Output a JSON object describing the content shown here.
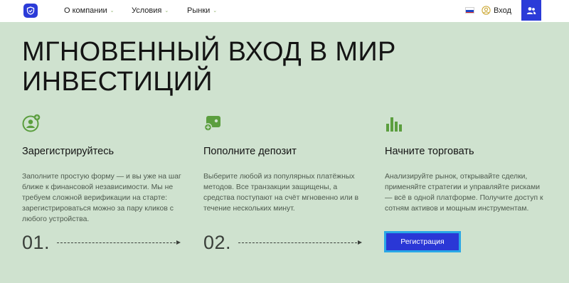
{
  "colors": {
    "accent": "#2b3bd8",
    "background": "#cfe2cf",
    "icon_green": "#5b9e3e",
    "button_border": "#2aa7e6"
  },
  "header": {
    "logo_icon": "shield-logo-icon",
    "nav": [
      {
        "label": "О компании"
      },
      {
        "label": "Условия"
      },
      {
        "label": "Рынки"
      }
    ],
    "login_label": "Вход",
    "flag_icon": "russia-flag-icon",
    "user_icon": "users-icon"
  },
  "hero": {
    "title_line1": "МГНОВЕННЫЙ ВХОД В МИР",
    "title_line2": "ИНВЕСТИЦИЙ"
  },
  "columns": [
    {
      "icon": "user-add-icon",
      "title": "Зарегистрируйтесь",
      "text": "Заполните простую форму — и вы уже на шаг ближе к финансовой независимости. Мы не требуем сложной верификации на старте: зарегистрироваться можно за пару кликов с любого устройства.",
      "step": "01."
    },
    {
      "icon": "wallet-plus-icon",
      "title": "Пополните депозит",
      "text": "Выберите любой из популярных платёжных методов. Все транзакции защищены, а средства поступают на счёт мгновенно или в течение нескольких минут.",
      "step": "02."
    },
    {
      "icon": "bar-chart-icon",
      "title": "Начните торговать",
      "text": "Анализируйте рынок, открывайте сделки, применяйте стратегии и управляйте рисками — всё в одной платформе. Получите доступ к сотням активов и мощным инструментам."
    }
  ],
  "cta": {
    "register_label": "Регистрация"
  }
}
